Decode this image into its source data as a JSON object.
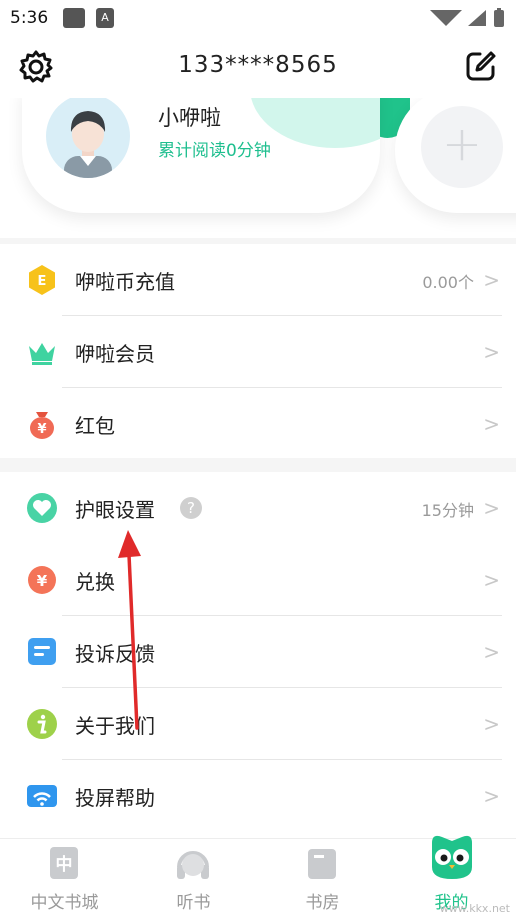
{
  "status_bar": {
    "time": "5:36",
    "notif_letter": "A"
  },
  "header": {
    "title": "133****8565",
    "settings_icon": "gear-icon",
    "edit_icon": "edit-icon"
  },
  "profile": {
    "name": "小咿啦",
    "reading_time": "累计阅读0分钟",
    "add_icon": "plus-icon"
  },
  "menu_group1": [
    {
      "label": "咿啦币充值",
      "value": "0.00个",
      "icon": "coin-icon"
    },
    {
      "label": "咿啦会员",
      "value": "",
      "icon": "crown-icon"
    },
    {
      "label": "红包",
      "value": "",
      "icon": "red-packet-icon"
    }
  ],
  "menu_group2": [
    {
      "label": "护眼设置",
      "value": "15分钟",
      "icon": "heart-icon",
      "help": "?"
    },
    {
      "label": "兑换",
      "value": "",
      "icon": "exchange-icon"
    },
    {
      "label": "投诉反馈",
      "value": "",
      "icon": "feedback-icon"
    },
    {
      "label": "关于我们",
      "value": "",
      "icon": "info-icon"
    },
    {
      "label": "投屏帮助",
      "value": "",
      "icon": "cast-icon"
    }
  ],
  "tabs": [
    {
      "label": "中文书城",
      "active": false,
      "glyph": "中"
    },
    {
      "label": "听书",
      "active": false
    },
    {
      "label": "书房",
      "active": false
    },
    {
      "label": "我的",
      "active": true
    }
  ],
  "watermark": "www.kkx.net",
  "colors": {
    "accent": "#20c38b",
    "light_accent": "#d2f6ec",
    "arrow": "#e02a2a"
  }
}
